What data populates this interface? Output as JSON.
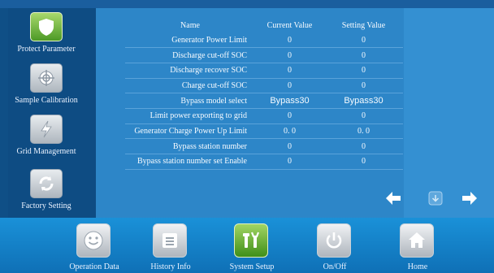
{
  "sidebar": {
    "items": [
      {
        "label": "Protect Parameter",
        "icon": "shield-icon",
        "active": true
      },
      {
        "label": "Sample Calibration",
        "icon": "calibration-icon",
        "active": false
      },
      {
        "label": "Grid Management",
        "icon": "lightning-icon",
        "active": false
      },
      {
        "label": "Factory Setting",
        "icon": "refresh-icon",
        "active": false
      }
    ]
  },
  "table": {
    "headers": {
      "name": "Name",
      "current": "Current Value",
      "setting": "Setting Value"
    },
    "rows": [
      {
        "name": "Generator Power Limit",
        "current": "0",
        "setting": "0"
      },
      {
        "name": "Discharge cut-off SOC",
        "current": "0",
        "setting": "0"
      },
      {
        "name": "Discharge recover SOC",
        "current": "0",
        "setting": "0"
      },
      {
        "name": "Charge cut-off SOC",
        "current": "0",
        "setting": "0"
      },
      {
        "name": "Bypass model select",
        "current": "Bypass30",
        "setting": "Bypass30"
      },
      {
        "name": "Limit power exporting to grid",
        "current": "0",
        "setting": "0"
      },
      {
        "name": "Generator Charge Power Up Limit",
        "current": "0. 0",
        "setting": "0. 0"
      },
      {
        "name": "Bypass station number",
        "current": "0",
        "setting": "0"
      },
      {
        "name": "Bypass station number set Enable",
        "current": "0",
        "setting": "0"
      }
    ]
  },
  "nav": {
    "icons": [
      "arrow-left-icon",
      "down-icon",
      "arrow-right-icon"
    ]
  },
  "bottombar": {
    "items": [
      {
        "label": "Operation Data",
        "icon": "smiley-icon",
        "active": false
      },
      {
        "label": "History Info",
        "icon": "list-icon",
        "active": false
      },
      {
        "label": "System Setup",
        "icon": "tools-icon",
        "active": true
      },
      {
        "label": "On/Off",
        "icon": "power-icon",
        "active": false
      },
      {
        "label": "Home",
        "icon": "home-icon",
        "active": false
      }
    ]
  },
  "colors": {
    "background": "#0f4f86",
    "panel": "#2d86c8",
    "active_green": "#5aa52b",
    "bottombar": "#1a91d8"
  }
}
